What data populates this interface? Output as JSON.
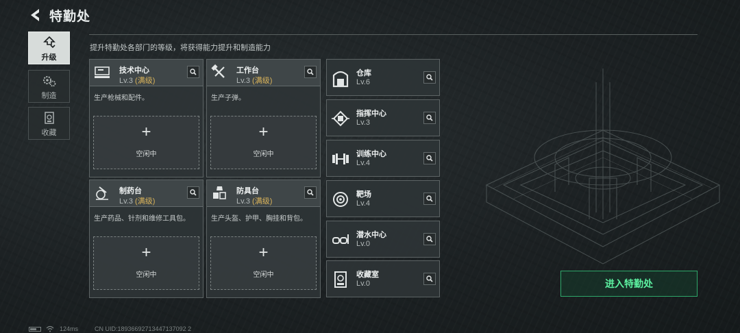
{
  "header": {
    "title": "特勤处",
    "subtitle": "提升特勤处各部门的等级，将获得能力提升和制造能力"
  },
  "tabs": [
    {
      "label": "升级",
      "icon": "upgrade-icon",
      "active": true
    },
    {
      "label": "制造",
      "icon": "gears-icon",
      "active": false
    },
    {
      "label": "收藏",
      "icon": "collection-icon",
      "active": false
    }
  ],
  "departments": [
    {
      "name": "技术中心",
      "level": "Lv.3",
      "maxed": "(满级)",
      "desc": "生产枪械和配件。",
      "slot_label": "空闲中",
      "icon": "tech-center-icon"
    },
    {
      "name": "工作台",
      "level": "Lv.3",
      "maxed": "(满级)",
      "desc": "生产子弹。",
      "slot_label": "空闲中",
      "icon": "workbench-icon"
    },
    {
      "name": "制药台",
      "level": "Lv.3",
      "maxed": "(满级)",
      "desc": "生产药品、针剂和维修工具包。",
      "slot_label": "空闲中",
      "icon": "pharmacy-icon"
    },
    {
      "name": "防具台",
      "level": "Lv.3",
      "maxed": "(满级)",
      "desc": "生产头盔、护甲、胸挂和背包。",
      "slot_label": "空闲中",
      "icon": "armor-bench-icon"
    }
  ],
  "facilities": [
    {
      "name": "仓库",
      "level": "Lv.6",
      "icon": "warehouse-icon"
    },
    {
      "name": "指挥中心",
      "level": "Lv.3",
      "icon": "command-center-icon"
    },
    {
      "name": "训练中心",
      "level": "Lv.4",
      "icon": "dumbbell-icon"
    },
    {
      "name": "靶场",
      "level": "Lv.4",
      "icon": "target-icon"
    },
    {
      "name": "潜水中心",
      "level": "Lv.0",
      "icon": "diving-mask-icon"
    },
    {
      "name": "收藏室",
      "level": "Lv.0",
      "icon": "collection-room-icon"
    }
  ],
  "enter_button": "进入特勤处",
  "status_bar": {
    "ping": "124ms",
    "uid": "CN UID:18936692713447137092 2"
  },
  "colors": {
    "accent_green": "#5cf0a0",
    "maxed_gold": "#d9b35a"
  }
}
